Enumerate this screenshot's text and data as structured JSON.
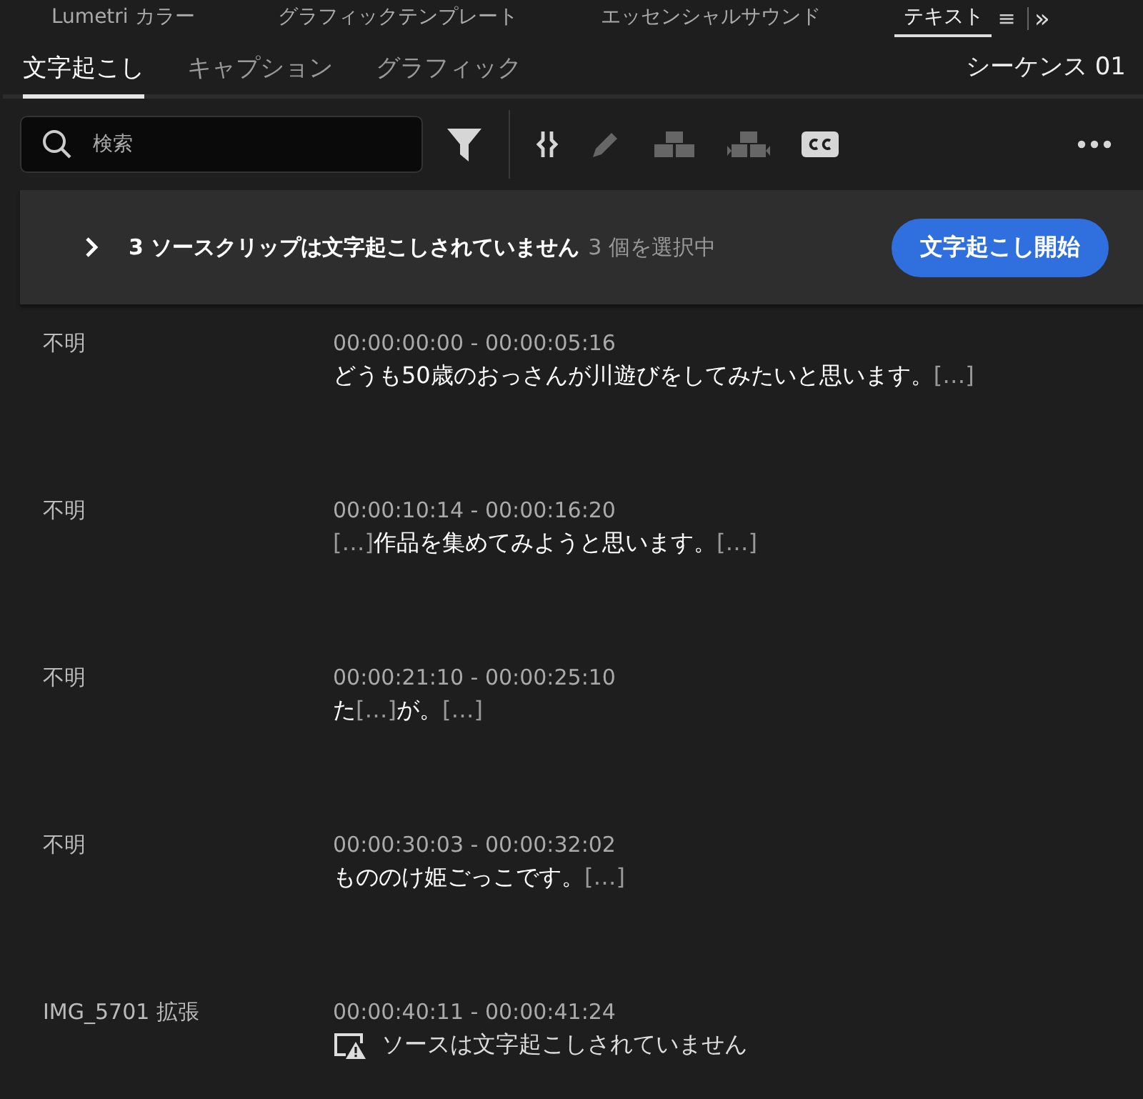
{
  "panel_tabs": [
    {
      "label": "Lumetri カラー",
      "selected": false
    },
    {
      "label": "グラフィックテンプレート",
      "selected": false
    },
    {
      "label": "エッセンシャルサウンド",
      "selected": false
    },
    {
      "label": "テキスト",
      "selected": true
    }
  ],
  "panel_menu": "≡",
  "overflow": "»",
  "sub_tabs": [
    {
      "label": "文字起こし",
      "selected": true
    },
    {
      "label": "キャプション",
      "selected": false
    },
    {
      "label": "グラフィック",
      "selected": false
    }
  ],
  "sequence": "シーケンス 01",
  "search": {
    "placeholder": "検索"
  },
  "tools": [
    {
      "kind": "filter",
      "disabled": false
    },
    {
      "kind": "split",
      "disabled": false
    },
    {
      "kind": "edit",
      "disabled": true
    },
    {
      "kind": "merge",
      "disabled": true
    },
    {
      "kind": "merge2",
      "disabled": true
    },
    {
      "kind": "cc",
      "disabled": false
    },
    {
      "kind": "more",
      "disabled": false
    }
  ],
  "banner": {
    "expanded": false,
    "message": "3 ソースクリップは文字起こしされていません",
    "selection": "3 個を選択中",
    "button": "文字起こし開始"
  },
  "rows": [
    {
      "speaker": "不明",
      "time": "00:00:00:00 - 00:00:05:16",
      "kind": "transcript",
      "segments": [
        {
          "kind": "speech",
          "text": "どうも50歳のおっさんが川遊びをしてみたいと思います。"
        },
        {
          "kind": "gap",
          "text": "[…]"
        }
      ]
    },
    {
      "speaker": "不明",
      "time": "00:00:10:14 - 00:00:16:20",
      "kind": "transcript",
      "segments": [
        {
          "kind": "gap",
          "text": "[…]"
        },
        {
          "kind": "speech",
          "text": "作品を集めてみようと思います。"
        },
        {
          "kind": "gap",
          "text": "[…]"
        }
      ]
    },
    {
      "speaker": "不明",
      "time": "00:00:21:10 - 00:00:25:10",
      "kind": "transcript",
      "segments": [
        {
          "kind": "speech",
          "text": "た"
        },
        {
          "kind": "gap",
          "text": "[…]"
        },
        {
          "kind": "speech",
          "text": "が。"
        },
        {
          "kind": "gap",
          "text": "[…]"
        }
      ]
    },
    {
      "speaker": "不明",
      "time": "00:00:30:03 - 00:00:32:02",
      "kind": "transcript",
      "segments": [
        {
          "kind": "speech",
          "text": "もののけ姫ごっこです。"
        },
        {
          "kind": "gap",
          "text": "[…]"
        }
      ]
    },
    {
      "speaker": "IMG_5701 拡張",
      "time": "00:00:40:11 - 00:00:41:24",
      "kind": "warning",
      "message": "ソースは文字起こしされていません"
    }
  ]
}
